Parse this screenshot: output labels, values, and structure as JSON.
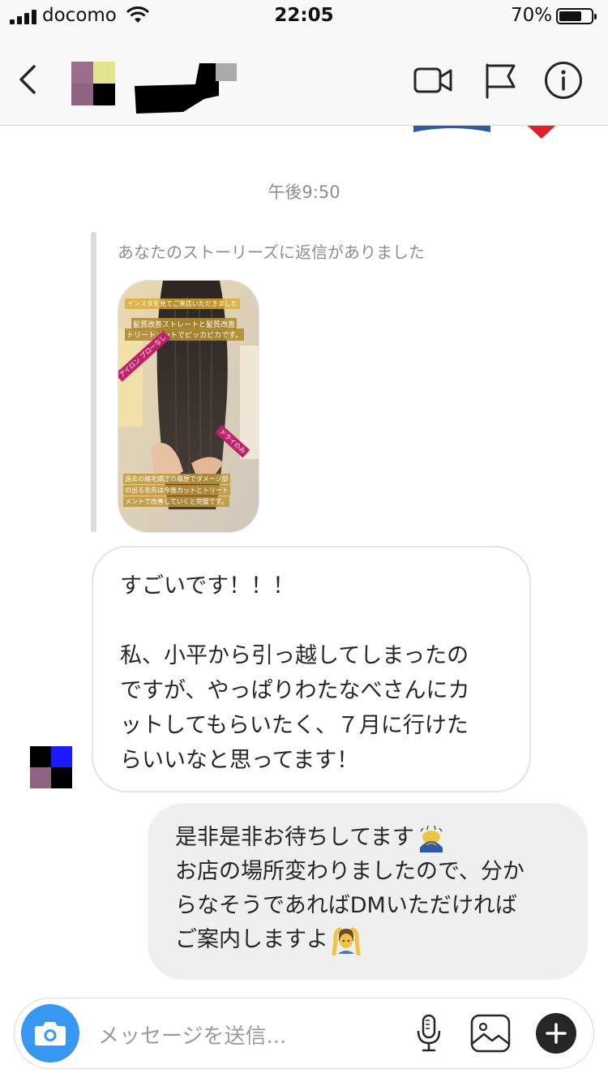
{
  "status_bar": {
    "carrier": "docomo",
    "time": "22:05",
    "battery_percent": "70%",
    "battery_level": 0.7
  },
  "header": {
    "back_icon": "chevron-left-icon",
    "video_icon": "video-camera-icon",
    "flag_icon": "flag-icon",
    "info_icon": "info-icon"
  },
  "thread": {
    "timestamp": "午後9:50",
    "story_reply_caption": "あなたのストーリーズに返信がありました",
    "story_thumb": {
      "caption_top": "インスタを見てご来店いただきました",
      "caption_main_1": "髪質改善ストレートと髪質改善",
      "caption_main_2": "トリートメントでピッカピカです。",
      "tag_left": "アイロン ブローなし",
      "tag_right": "ドライのみ",
      "caption_bottom_1": "過去の縮毛矯正の履歴でダメージ部",
      "caption_bottom_2": "の出る毛先は今後カットとトリート",
      "caption_bottom_3": "メントで改善していくと完璧です。"
    },
    "incoming_message": {
      "line1": "すごいです！！！",
      "line2": "私、小平から引っ越してしまったの",
      "line3": "ですが、やっぱりわたなべさんにカ",
      "line4": "ットしてもらいたく、７月に行けた",
      "line5": "らいいなと思ってます！"
    },
    "outgoing_message": {
      "line1": "是非是非お待ちしてます",
      "line2": "お店の場所変わりましたので、分か",
      "line3": "らなそうであればDMいただければ",
      "line4": "ご案内しますよ",
      "emoji1": "bowing-person-emoji",
      "emoji2": "ok-gesture-person-emoji"
    }
  },
  "composer": {
    "placeholder": "メッセージを送信...",
    "camera_icon": "camera-icon",
    "mic_icon": "microphone-icon",
    "gallery_icon": "image-icon",
    "plus_icon": "plus-icon"
  },
  "colors": {
    "accent_blue": "#3897f0",
    "incoming_border": "#e3e3e3",
    "outgoing_bg": "#efefef",
    "muted_text": "#8e8e8e"
  }
}
